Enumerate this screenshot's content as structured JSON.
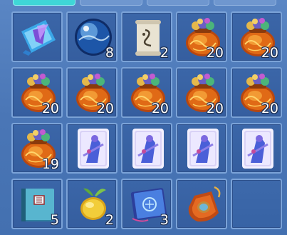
{
  "inventory": {
    "columns": 5,
    "rows": 4,
    "slots": [
      {
        "icon": "crystal-scroll-icon",
        "count": ""
      },
      {
        "icon": "spirit-orb-icon",
        "count": "8"
      },
      {
        "icon": "rune-scroll-icon",
        "count": "2"
      },
      {
        "icon": "treasure-pouch-icon",
        "count": "20"
      },
      {
        "icon": "treasure-pouch-icon",
        "count": "20"
      },
      {
        "icon": "treasure-pouch-icon",
        "count": "20"
      },
      {
        "icon": "treasure-pouch-icon",
        "count": "20"
      },
      {
        "icon": "treasure-pouch-icon",
        "count": "20"
      },
      {
        "icon": "treasure-pouch-icon",
        "count": "20"
      },
      {
        "icon": "treasure-pouch-icon",
        "count": "20"
      },
      {
        "icon": "treasure-pouch-icon",
        "count": "19"
      },
      {
        "icon": "character-card-icon",
        "count": ""
      },
      {
        "icon": "character-card-icon",
        "count": ""
      },
      {
        "icon": "character-card-icon",
        "count": ""
      },
      {
        "icon": "character-card-icon",
        "count": ""
      },
      {
        "icon": "blue-book-icon",
        "count": "5"
      },
      {
        "icon": "golden-fruit-icon",
        "count": "2"
      },
      {
        "icon": "spell-tome-icon",
        "count": "3"
      },
      {
        "icon": "orange-amulet-bag-icon",
        "count": ""
      },
      {
        "icon": "",
        "count": ""
      }
    ]
  },
  "colors": {
    "panel": "#4a76b6",
    "slot": "#3763a5",
    "slot_border": "#7ba3d8",
    "active_tab": "#3fd7d7"
  }
}
